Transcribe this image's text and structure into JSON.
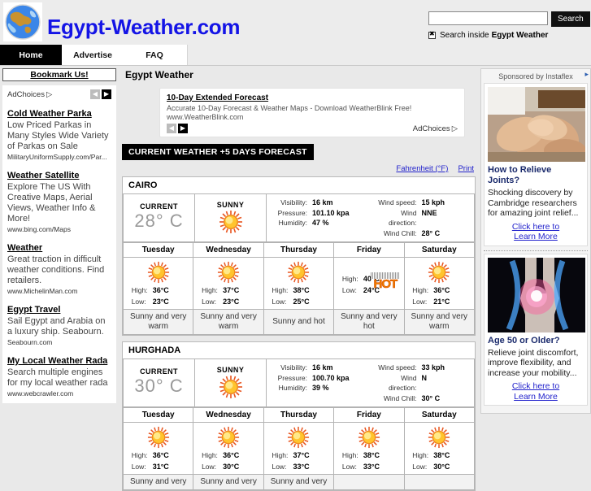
{
  "header": {
    "site_title": "Egypt-Weather.com",
    "logo_icon": "globe-icon",
    "search": {
      "value": "",
      "placeholder": "",
      "button_label": "Search",
      "scope_prefix": "Search inside",
      "scope_site": "Egypt Weather",
      "checkbox_icon": "checked-box-icon"
    }
  },
  "nav": {
    "items": [
      {
        "label": "Home",
        "active": true
      },
      {
        "label": "Advertise",
        "active": false
      },
      {
        "label": "FAQ",
        "active": false
      }
    ]
  },
  "sidebar_left": {
    "bookmark_label": "Bookmark Us!",
    "adchoices_label": "AdChoices",
    "prev_icon": "chevron-left-icon",
    "next_icon": "chevron-right-icon",
    "ads": [
      {
        "title": "Cold Weather Parka",
        "desc": "Low Priced Parkas in Many Styles Wide Variety of Parkas on Sale",
        "url": "MilitaryUniformSupply.com/Par..."
      },
      {
        "title": "Weather Satellite",
        "desc": "Explore The US With Creative Maps, Aerial Views, Weather Info & More!",
        "url": "www.bing.com/Maps"
      },
      {
        "title": "Weather",
        "desc": "Great traction in difficult weather conditions. Find retailers.",
        "url": "www.MichelinMan.com"
      },
      {
        "title": "Egypt Travel",
        "desc": "Sail Egypt and Arabia on a luxury ship. Seabourn.",
        "url": "Seabourn.com"
      },
      {
        "title": "My Local Weather Rada",
        "desc": "Search multiple engines for my local weather rada",
        "url": "www.webcrawler.com"
      }
    ]
  },
  "main": {
    "page_title": "Egypt Weather",
    "top_ad": {
      "title": "10-Day Extended Forecast",
      "desc": "Accurate 10-Day Forecast & Weather Maps - Download WeatherBlink Free!",
      "url": "www.WeatherBlink.com",
      "adchoices_label": "AdChoices",
      "prev_icon": "chevron-left-icon",
      "next_icon": "chevron-right-icon"
    },
    "section_bar": "CURRENT WEATHER +5 DAYS FORECAST",
    "links": [
      {
        "label": "Fahrenheit (°F)"
      },
      {
        "label": "Print"
      }
    ],
    "detail_keys": {
      "visibility": "Visibility:",
      "pressure": "Pressure:",
      "humidity": "Humidity:",
      "wind_speed": "Wind speed:",
      "wind_direction": "Wind direction:",
      "wind_chill": "Wind Chill:"
    },
    "hl_keys": {
      "high": "High:",
      "low": "Low:"
    },
    "current_label": "CURRENT",
    "cities": [
      {
        "name": "CAIRO",
        "current": {
          "temp": "28° C",
          "condition": "SUNNY",
          "icon": "sun-icon",
          "visibility": "16 km",
          "pressure": "101.10 kpa",
          "humidity": "47 %",
          "wind_speed": "15 kph",
          "wind_direction": "NNE",
          "wind_chill": "28° C"
        },
        "forecast": [
          {
            "day": "Tuesday",
            "icon": "sun-icon",
            "high": "36°C",
            "low": "23°C",
            "desc": "Sunny and very warm"
          },
          {
            "day": "Wednesday",
            "icon": "sun-icon",
            "high": "37°C",
            "low": "23°C",
            "desc": "Sunny and very warm"
          },
          {
            "day": "Thursday",
            "icon": "sun-icon",
            "high": "38°C",
            "low": "25°C",
            "desc": "Sunny and hot"
          },
          {
            "day": "Friday",
            "icon": "hot-icon",
            "high": "40°C",
            "low": "24°C",
            "desc": "Sunny and very hot"
          },
          {
            "day": "Saturday",
            "icon": "sun-icon",
            "high": "36°C",
            "low": "21°C",
            "desc": "Sunny and very warm"
          }
        ]
      },
      {
        "name": "HURGHADA",
        "current": {
          "temp": "30° C",
          "condition": "SUNNY",
          "icon": "sun-icon",
          "visibility": "16 km",
          "pressure": "100.70 kpa",
          "humidity": "39 %",
          "wind_speed": "33 kph",
          "wind_direction": "N",
          "wind_chill": "30° C"
        },
        "forecast": [
          {
            "day": "Tuesday",
            "icon": "sun-icon",
            "high": "36°C",
            "low": "31°C",
            "desc": "Sunny and very"
          },
          {
            "day": "Wednesday",
            "icon": "sun-icon",
            "high": "36°C",
            "low": "30°C",
            "desc": "Sunny and very"
          },
          {
            "day": "Thursday",
            "icon": "sun-icon",
            "high": "37°C",
            "low": "33°C",
            "desc": "Sunny and very"
          },
          {
            "day": "Friday",
            "icon": "sun-icon",
            "high": "38°C",
            "low": "33°C",
            "desc": ""
          },
          {
            "day": "Saturday",
            "icon": "sun-icon",
            "high": "38°C",
            "low": "30°C",
            "desc": ""
          }
        ]
      }
    ]
  },
  "sidebar_right": {
    "sponsor_label": "Sponsored by Instaflex",
    "adchoices_icon": "adchoices-icon",
    "ads": [
      {
        "image": "hands-on-knee-photo",
        "head": "How to Relieve Joints?",
        "body": "Shocking discovery by Cambridge researchers for amazing joint relief...",
        "cta_line1": "Click here to",
        "cta_line2": "Learn More"
      },
      {
        "image": "glowing-knee-xray-photo",
        "head": "Age 50 or Older?",
        "body": "Relieve joint discomfort, improve flexibility, and increase your mobility...",
        "cta_line1": "Click here to",
        "cta_line2": "Learn More"
      }
    ]
  },
  "colors": {
    "link": "#2222cc",
    "brand": "#1414e6",
    "sun": "#ffb300",
    "hot": "#f08000",
    "bar_bg": "#000000"
  }
}
